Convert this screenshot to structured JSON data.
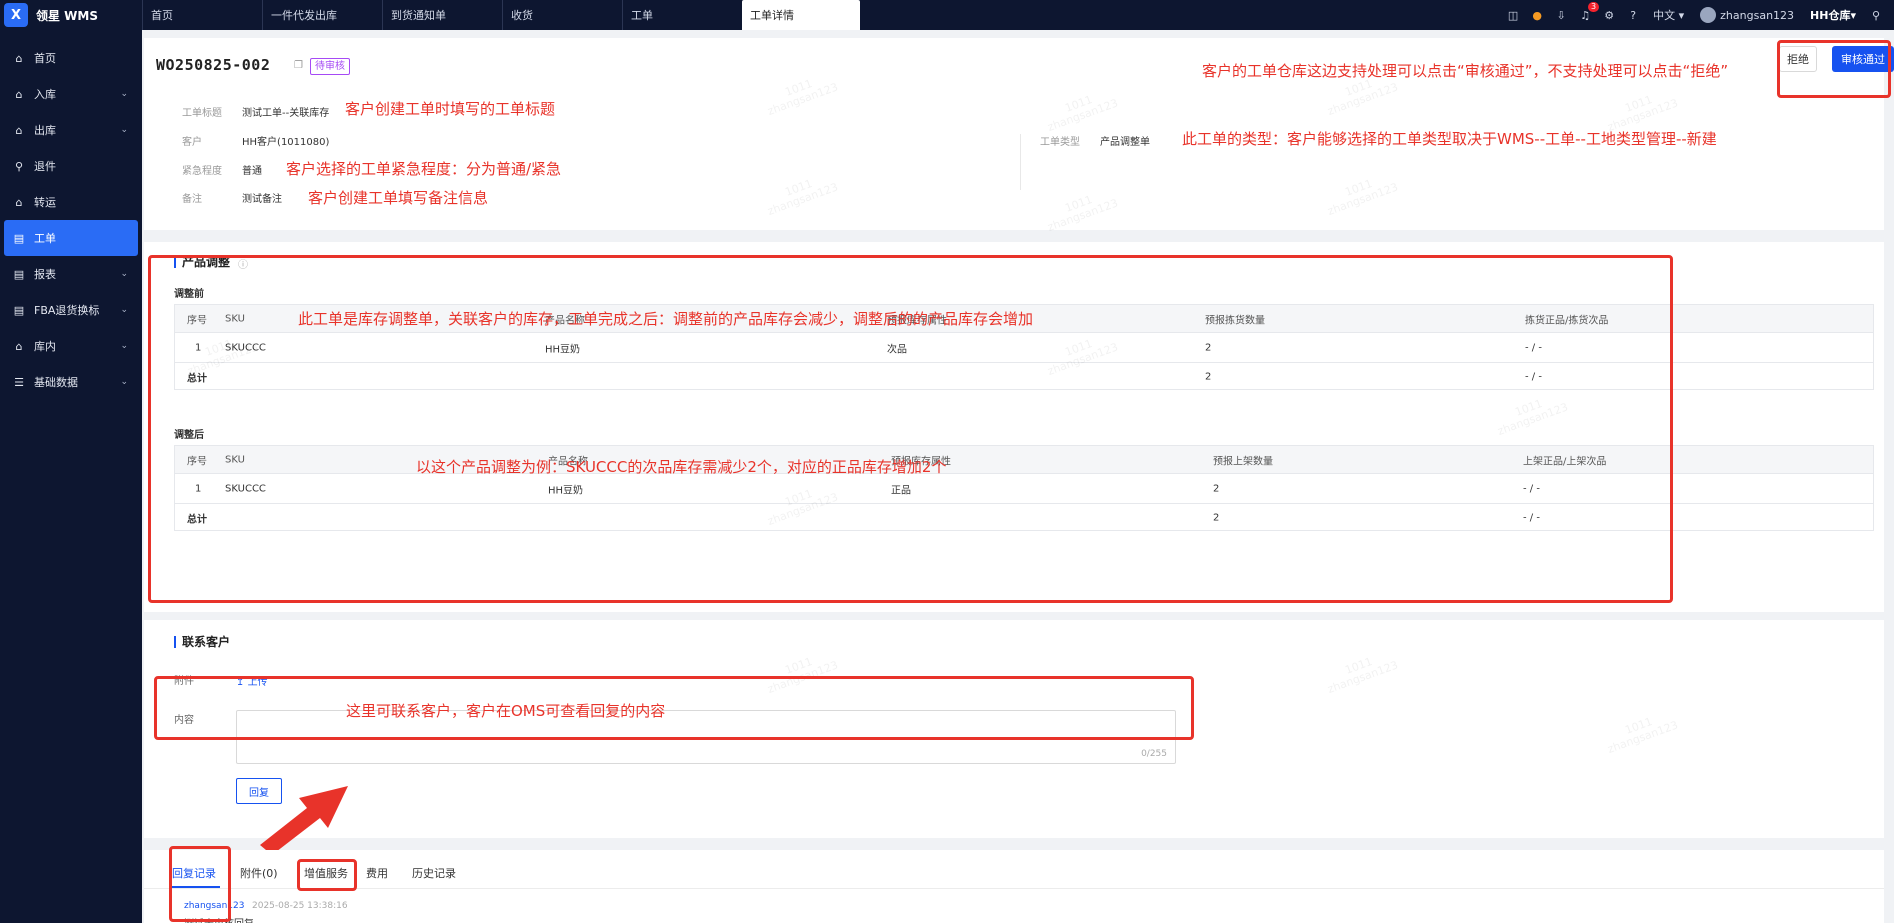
{
  "app": {
    "logo_letter": "X",
    "name": "领星 WMS"
  },
  "tabs": [
    "首页",
    "一件代发出库",
    "到货通知单",
    "收货",
    "工单",
    "工单详情"
  ],
  "topbar": {
    "notification_count": "3",
    "language": "中文",
    "username": "zhangsan123",
    "warehouse": "HH仓库"
  },
  "sidebar": [
    {
      "label": "首页",
      "icon": "home-icon"
    },
    {
      "label": "入库",
      "icon": "inbound-icon",
      "chevron": true
    },
    {
      "label": "出库",
      "icon": "outbound-icon",
      "chevron": true
    },
    {
      "label": "退件",
      "icon": "return-icon"
    },
    {
      "label": "转运",
      "icon": "transfer-icon"
    },
    {
      "label": "工单",
      "icon": "workorder-icon",
      "active": true
    },
    {
      "label": "报表",
      "icon": "report-icon",
      "chevron": true
    },
    {
      "label": "FBA退货换标",
      "icon": "fba-icon",
      "chevron": true
    },
    {
      "label": "库内",
      "icon": "warehouse-icon",
      "chevron": true
    },
    {
      "label": "基础数据",
      "icon": "data-icon",
      "chevron": true
    }
  ],
  "header": {
    "wo_number": "WO250825-002",
    "status": "待审核",
    "reject_label": "拒绝",
    "approve_label": "审核通过"
  },
  "watermark": {
    "line1": "1011",
    "line2": "zhangsan123"
  },
  "info": {
    "title_label": "工单标题",
    "title_value": "测试工单--关联库存",
    "customer_label": "客户",
    "customer_value": "HH客户(1011080)",
    "urgency_label": "紧急程度",
    "urgency_value": "普通",
    "remark_label": "备注",
    "remark_value": "测试备注",
    "type_label": "工单类型",
    "type_value": "产品调整单"
  },
  "notes": {
    "approve": "客户的工单仓库这边支持处理可以点击“审核通过”，不支持处理可以点击“拒绝”",
    "title": "客户创建工单时填写的工单标题",
    "type": "此工单的类型：客户能够选择的工单类型取决于WMS--工单--工地类型管理--新建",
    "urgency": "客户选择的工单紧急程度：分为普通/紧急",
    "remark": "客户创建工单填写备注信息",
    "adjust": "此工单是库存调整单，关联客户的库存，工单完成之后：调整前的产品库存会减少，调整后的的产品库存会增加",
    "example": "以这个产品调整为例：SKUCCC的次品库存需减少2个，对应的正品库存增加2个",
    "contact": "这里可联系客户，客户在OMS可查看回复的内容"
  },
  "adjust": {
    "section_title": "产品调整",
    "before": {
      "title": "调整前",
      "headers": [
        "序号",
        "SKU",
        "产品名称",
        "预报库存属性",
        "预报拣货数量",
        "拣货正品/拣货次品"
      ],
      "row": [
        "1",
        "SKUCCC",
        "HH豆奶",
        "次品",
        "2",
        "- / -"
      ],
      "total_label": "总计",
      "total_qty": "2",
      "total_pick": "- / -"
    },
    "after": {
      "title": "调整后",
      "headers": [
        "序号",
        "SKU",
        "产品名称",
        "预报库存属性",
        "预报上架数量",
        "上架正品/上架次品"
      ],
      "row": [
        "1",
        "SKUCCC",
        "HH豆奶",
        "正品",
        "2",
        "- / -"
      ],
      "total_label": "总计",
      "total_qty": "2",
      "total_pick": "- / -"
    }
  },
  "contact": {
    "section_title": "联系客户",
    "attachment_label": "附件",
    "upload_label": "上传",
    "content_label": "内容",
    "counter": "0/255",
    "reply_button": "回复"
  },
  "records": {
    "tabs": [
      "回复记录",
      "附件(0)",
      "增值服务",
      "费用",
      "历史记录"
    ],
    "user": "zhangsan123",
    "time": "2025-08-25 13:38:16",
    "text": "测试未审核回复"
  }
}
